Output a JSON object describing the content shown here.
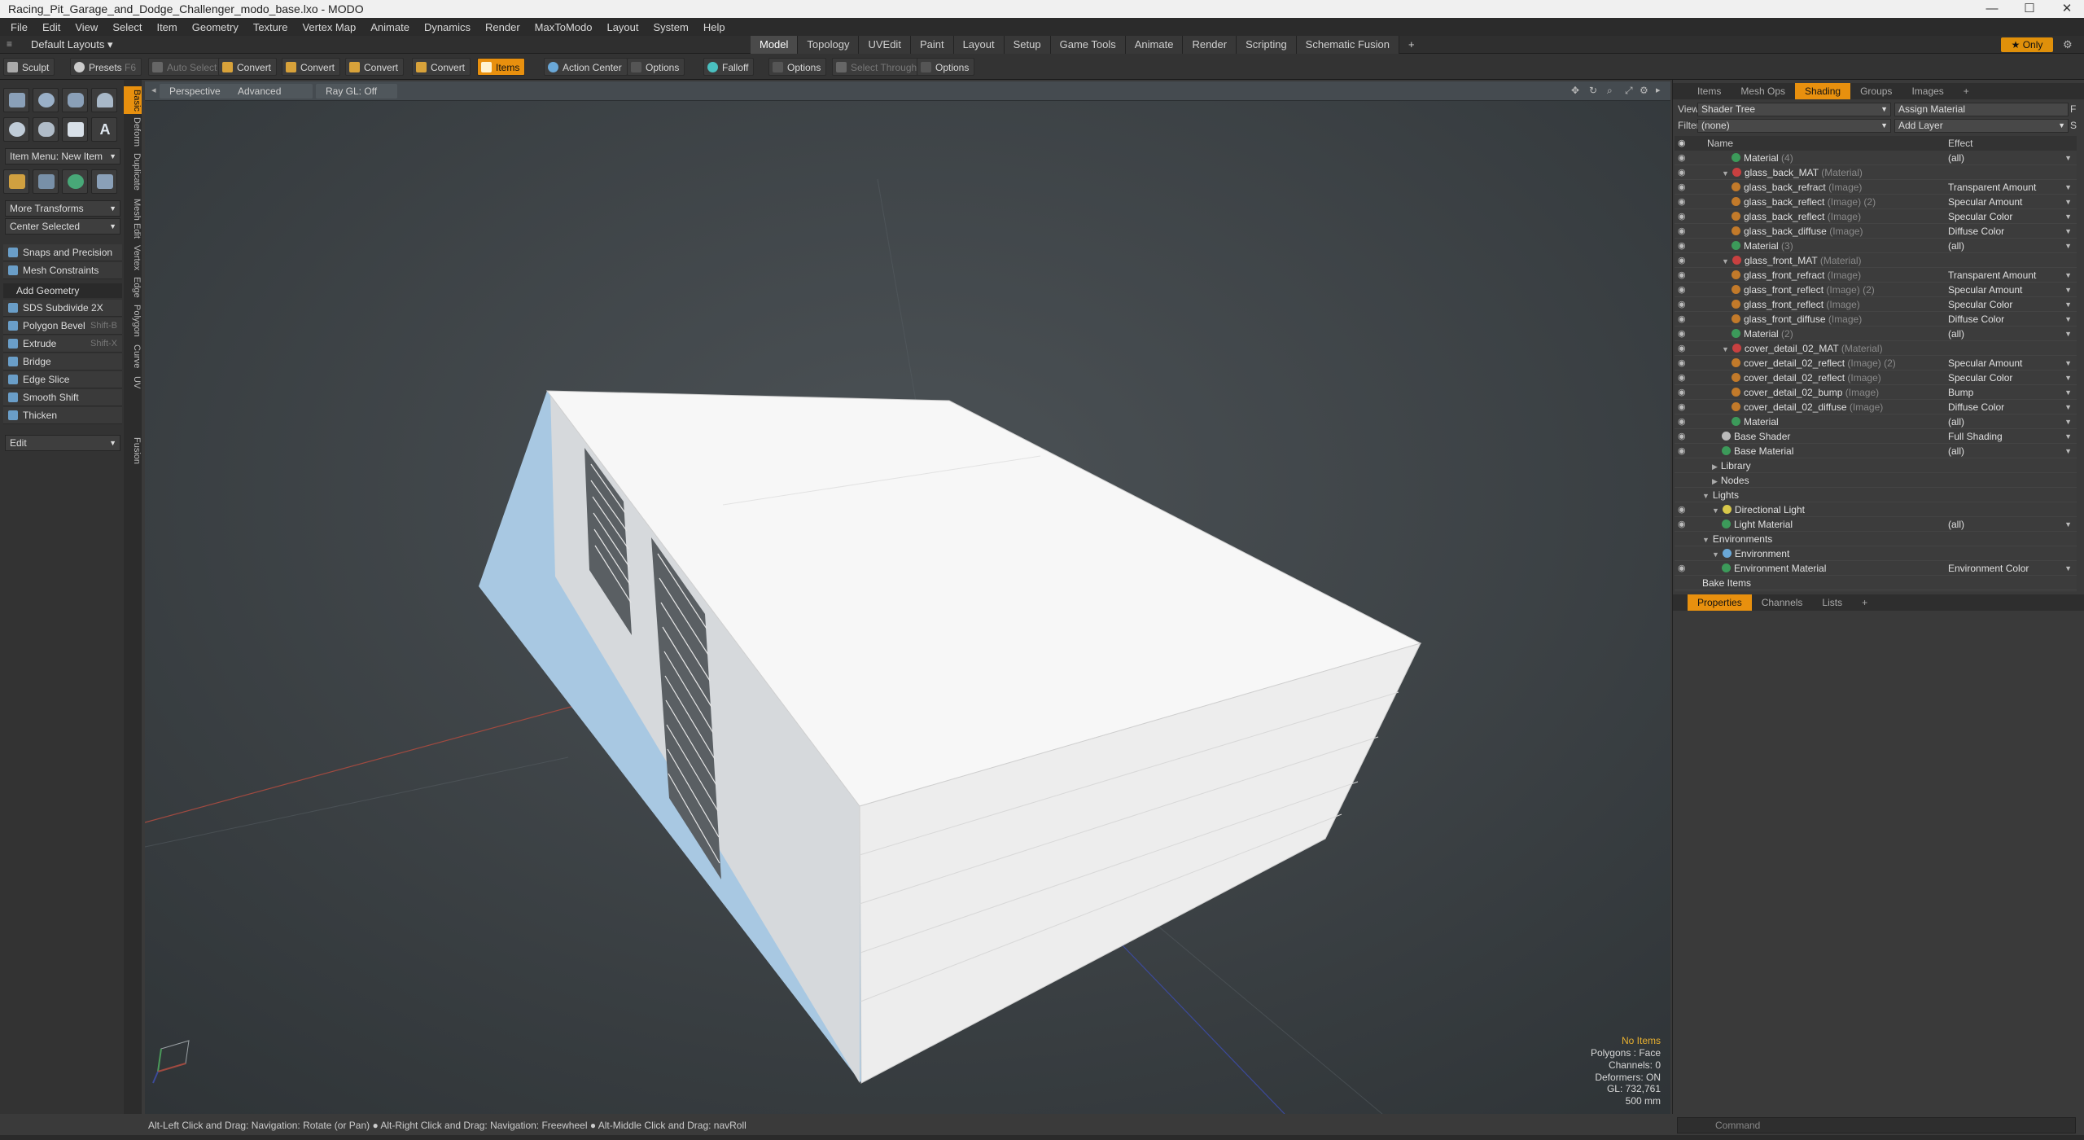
{
  "window": {
    "title": "Racing_Pit_Garage_and_Dodge_Challenger_modo_base.lxo - MODO",
    "controls": [
      "—",
      "☐",
      "✕"
    ]
  },
  "menu": [
    "File",
    "Edit",
    "View",
    "Select",
    "Item",
    "Geometry",
    "Texture",
    "Vertex Map",
    "Animate",
    "Dynamics",
    "Render",
    "MaxToModo",
    "Layout",
    "System",
    "Help"
  ],
  "layouts": {
    "selector": "Default Layouts",
    "tabs": [
      "Model",
      "Topology",
      "UVEdit",
      "Paint",
      "Layout",
      "Setup",
      "Game Tools",
      "Animate",
      "Render",
      "Scripting",
      "Schematic Fusion"
    ],
    "active": "Model",
    "plus": "+",
    "only": "★ Only"
  },
  "toolbar": {
    "sculpt": "Sculpt",
    "presets": "Presets",
    "presets_key": "F6",
    "auto_select": "Auto Select",
    "convert1": "Convert",
    "convert2": "Convert",
    "convert3": "Convert",
    "convert4": "Convert",
    "items": "Items",
    "action_center": "Action Center",
    "options1": "Options",
    "falloff": "Falloff",
    "options2": "Options",
    "select_through": "Select Through",
    "options3": "Options"
  },
  "toolbox": {
    "item_menu": "Item Menu: New Item",
    "more_transforms": "More Transforms",
    "center_selected": "Center Selected",
    "snaps": "Snaps and Precision",
    "mesh_constraints": "Mesh Constraints",
    "add_geometry": "Add Geometry",
    "tools": [
      {
        "label": "SDS Subdivide 2X",
        "key": ""
      },
      {
        "label": "Polygon Bevel",
        "key": "Shift-B"
      },
      {
        "label": "Extrude",
        "key": "Shift-X"
      },
      {
        "label": "Bridge",
        "key": ""
      },
      {
        "label": "Edge Slice",
        "key": ""
      },
      {
        "label": "Smooth Shift",
        "key": ""
      },
      {
        "label": "Thicken",
        "key": ""
      }
    ],
    "edit": "Edit",
    "vtabs": [
      "Basic",
      "Deform",
      "Duplicate",
      "Mesh Edit",
      "Vertex",
      "Edge",
      "Polygon",
      "Curve",
      "UV",
      "Fusion"
    ]
  },
  "viewport": {
    "perspective": "Perspective",
    "advanced": "Advanced",
    "raygl": "Ray GL: Off",
    "info": {
      "no_items": "No Items",
      "polygons": "Polygons : Face",
      "channels": "Channels: 0",
      "deformers": "Deformers: ON",
      "gl": "GL: 732,761",
      "scale": "500 mm"
    }
  },
  "status": "Alt-Left Click and Drag: Navigation: Rotate (or Pan) ● Alt-Right Click and Drag: Navigation: Freewheel ● Alt-Middle Click and Drag: navRoll",
  "rpanel": {
    "tabs": [
      "Items",
      "Mesh Ops",
      "Shading",
      "Groups",
      "Images",
      "+"
    ],
    "active_tab": "Shading",
    "view_label": "View",
    "view_value": "Shader Tree",
    "assign": "Assign Material",
    "f_key": "F",
    "filter_label": "Filter",
    "filter_value": "(none)",
    "add_layer": "Add Layer",
    "s_key": "S",
    "col_name": "Name",
    "col_effect": "Effect",
    "rows": [
      {
        "indent": 3,
        "name": "Material",
        "kind": "(4)",
        "effect": "(all)",
        "color": "#3c9a5a",
        "eye": true
      },
      {
        "indent": 2,
        "name": "glass_back_MAT",
        "kind": "(Material)",
        "effect": "",
        "color": "#c84040",
        "eye": true,
        "toggle": "▼"
      },
      {
        "indent": 3,
        "name": "glass_back_refract",
        "kind": "(Image)",
        "effect": "Transparent Amount",
        "color": "#c27a2a",
        "eye": true
      },
      {
        "indent": 3,
        "name": "glass_back_reflect",
        "kind": "(Image) (2)",
        "effect": "Specular Amount",
        "color": "#c27a2a",
        "eye": true
      },
      {
        "indent": 3,
        "name": "glass_back_reflect",
        "kind": "(Image)",
        "effect": "Specular Color",
        "color": "#c27a2a",
        "eye": true
      },
      {
        "indent": 3,
        "name": "glass_back_diffuse",
        "kind": "(Image)",
        "effect": "Diffuse Color",
        "color": "#c27a2a",
        "eye": true
      },
      {
        "indent": 3,
        "name": "Material",
        "kind": "(3)",
        "effect": "(all)",
        "color": "#3c9a5a",
        "eye": true
      },
      {
        "indent": 2,
        "name": "glass_front_MAT",
        "kind": "(Material)",
        "effect": "",
        "color": "#c84040",
        "eye": true,
        "toggle": "▼"
      },
      {
        "indent": 3,
        "name": "glass_front_refract",
        "kind": "(Image)",
        "effect": "Transparent Amount",
        "color": "#c27a2a",
        "eye": true
      },
      {
        "indent": 3,
        "name": "glass_front_reflect",
        "kind": "(Image) (2)",
        "effect": "Specular Amount",
        "color": "#c27a2a",
        "eye": true
      },
      {
        "indent": 3,
        "name": "glass_front_reflect",
        "kind": "(Image)",
        "effect": "Specular Color",
        "color": "#c27a2a",
        "eye": true
      },
      {
        "indent": 3,
        "name": "glass_front_diffuse",
        "kind": "(Image)",
        "effect": "Diffuse Color",
        "color": "#c27a2a",
        "eye": true
      },
      {
        "indent": 3,
        "name": "Material",
        "kind": "(2)",
        "effect": "(all)",
        "color": "#3c9a5a",
        "eye": true
      },
      {
        "indent": 2,
        "name": "cover_detail_02_MAT",
        "kind": "(Material)",
        "effect": "",
        "color": "#c84040",
        "eye": true,
        "toggle": "▼"
      },
      {
        "indent": 3,
        "name": "cover_detail_02_reflect",
        "kind": "(Image) (2)",
        "effect": "Specular Amount",
        "color": "#c27a2a",
        "eye": true
      },
      {
        "indent": 3,
        "name": "cover_detail_02_reflect",
        "kind": "(Image)",
        "effect": "Specular Color",
        "color": "#c27a2a",
        "eye": true
      },
      {
        "indent": 3,
        "name": "cover_detail_02_bump",
        "kind": "(Image)",
        "effect": "Bump",
        "color": "#c27a2a",
        "eye": true
      },
      {
        "indent": 3,
        "name": "cover_detail_02_diffuse",
        "kind": "(Image)",
        "effect": "Diffuse Color",
        "color": "#c27a2a",
        "eye": true
      },
      {
        "indent": 3,
        "name": "Material",
        "kind": "",
        "effect": "(all)",
        "color": "#3c9a5a",
        "eye": true
      },
      {
        "indent": 2,
        "name": "Base Shader",
        "kind": "",
        "effect": "Full Shading",
        "color": "#bbbbbb",
        "eye": true
      },
      {
        "indent": 2,
        "name": "Base Material",
        "kind": "",
        "effect": "(all)",
        "color": "#3c9a5a",
        "eye": true
      },
      {
        "indent": 1,
        "name": "Library",
        "kind": "",
        "effect": "",
        "color": "",
        "eye": false,
        "toggle": "▶"
      },
      {
        "indent": 1,
        "name": "Nodes",
        "kind": "",
        "effect": "",
        "color": "",
        "eye": false,
        "toggle": "▶"
      },
      {
        "indent": 0,
        "name": "Lights",
        "kind": "",
        "effect": "",
        "color": "",
        "eye": false,
        "toggle": "▼"
      },
      {
        "indent": 1,
        "name": "Directional Light",
        "kind": "",
        "effect": "",
        "color": "#d8c84a",
        "eye": true,
        "toggle": "▼"
      },
      {
        "indent": 2,
        "name": "Light Material",
        "kind": "",
        "effect": "(all)",
        "color": "#3c9a5a",
        "eye": true
      },
      {
        "indent": 0,
        "name": "Environments",
        "kind": "",
        "effect": "",
        "color": "",
        "eye": false,
        "toggle": "▼"
      },
      {
        "indent": 1,
        "name": "Environment",
        "kind": "",
        "effect": "",
        "color": "#6aa8d8",
        "eye": false,
        "toggle": "▼"
      },
      {
        "indent": 2,
        "name": "Environment Material",
        "kind": "",
        "effect": "Environment Color",
        "color": "#3c9a5a",
        "eye": true
      },
      {
        "indent": 0,
        "name": "Bake Items",
        "kind": "",
        "effect": "",
        "color": "",
        "eye": false
      }
    ],
    "prop_tabs": [
      "Properties",
      "Channels",
      "Lists",
      "+"
    ],
    "command_placeholder": "Command"
  },
  "colors": {
    "accent": "#e8900e",
    "building": "#f2f2f2",
    "glass": "#b8d4ea"
  }
}
